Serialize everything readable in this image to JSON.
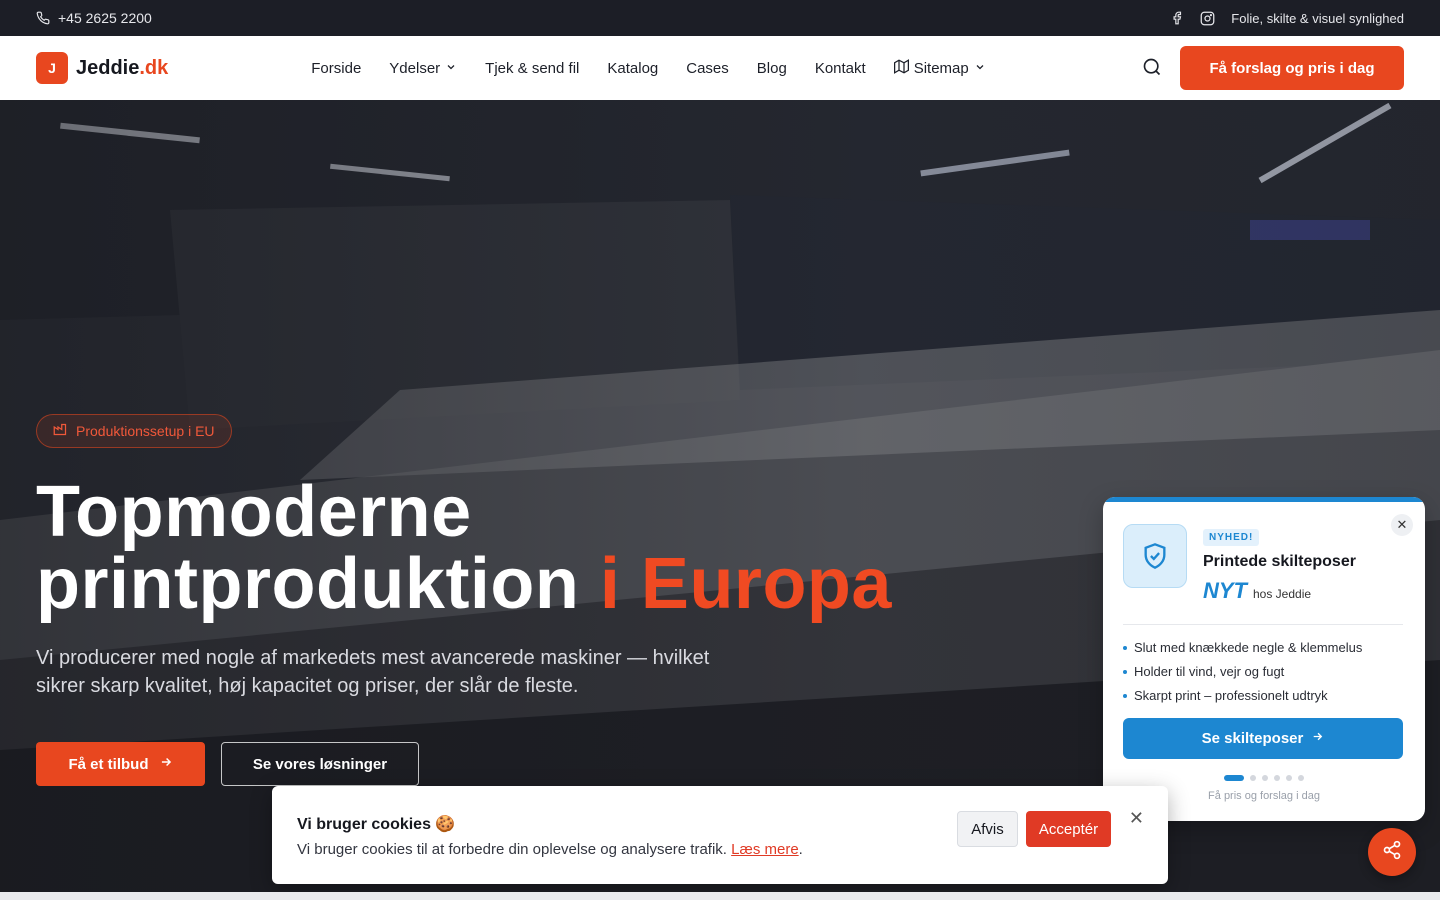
{
  "topbar": {
    "phone": "+45 2625 2200",
    "tagline": "Folie, skilte & visuel synlighed",
    "icons": [
      "phone-icon",
      "facebook-icon",
      "instagram-icon"
    ]
  },
  "header": {
    "logo_mark": "J",
    "logo_name": "Jeddie",
    "logo_tld": ".dk",
    "nav": [
      {
        "label": "Forside"
      },
      {
        "label": "Ydelser"
      },
      {
        "label": "Tjek & send fil"
      },
      {
        "label": "Katalog"
      },
      {
        "label": "Cases"
      },
      {
        "label": "Blog"
      },
      {
        "label": "Kontakt"
      },
      {
        "label": "Sitemap"
      }
    ],
    "cta": "Få forslag og pris i dag"
  },
  "hero": {
    "pill": "Produktionssetup i EU",
    "title_line1": "Topmoderne",
    "title_line2": "printproduktion",
    "title_accent": "i Europa",
    "subtitle": "Vi producerer med nogle af markedets mest avancerede maskiner — hvilket sikrer skarp kvalitet, høj kapacitet og priser, der slår de fleste.",
    "primary_btn": "Få et tilbud",
    "secondary_btn": "Se vores løsninger"
  },
  "promo": {
    "badge": "NYHED!",
    "title": "Printede skilteposer",
    "new_big": "NYT",
    "new_small": "hos Jeddie",
    "bullets": [
      "Slut med knækkede negle & klemmelus",
      "Holder til vind, vejr og fugt",
      "Skarpt print – professionelt udtryk"
    ],
    "button": "Se skilteposer",
    "slides": 6,
    "active_slide": 1,
    "footer": "Få pris og forslag i dag"
  },
  "cookie": {
    "title": "Vi bruger cookies 🍪",
    "text": "Vi bruger cookies til at forbedre din oplevelse og analysere trafik.",
    "link": "Læs mere",
    "period": ".",
    "reject": "Afvis",
    "accept": "Acceptér"
  },
  "colors": {
    "accent": "#e8471f",
    "promo_blue": "#1d87d1",
    "topbar": "#1c1e26"
  }
}
